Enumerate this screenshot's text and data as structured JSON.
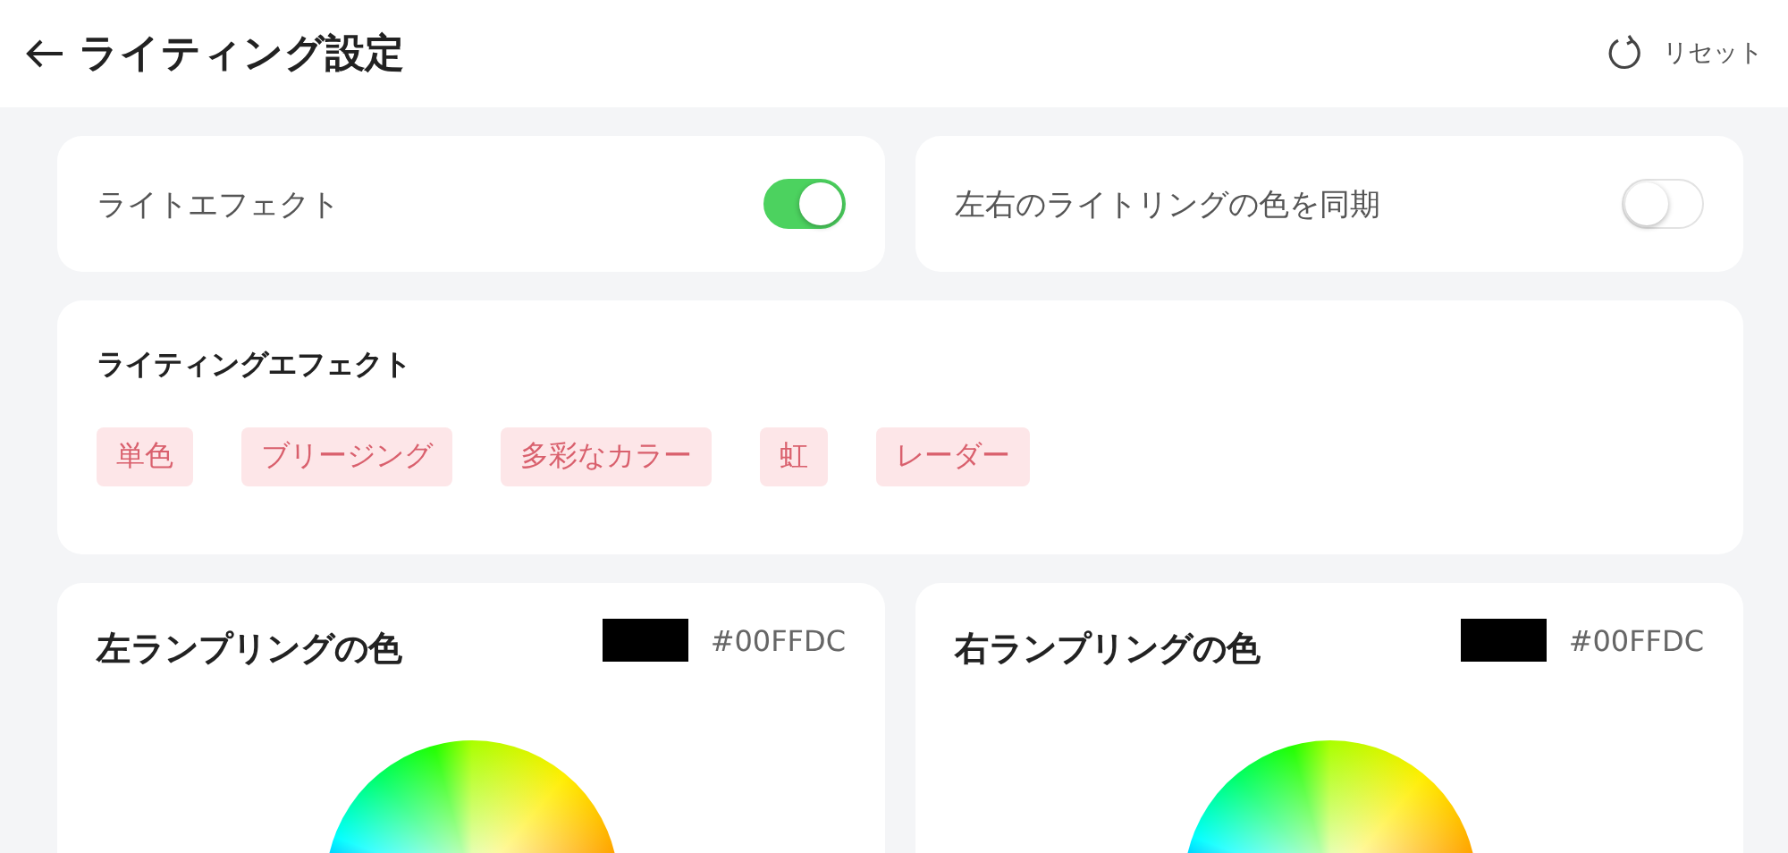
{
  "header": {
    "title": "ライティング設定",
    "reset_label": "リセット"
  },
  "toggles": [
    {
      "label": "ライトエフェクト",
      "on": true
    },
    {
      "label": "左右のライトリングの色を同期",
      "on": false
    }
  ],
  "effects": {
    "title": "ライティングエフェクト",
    "options": [
      {
        "label": "単色",
        "selected": false
      },
      {
        "label": "ブリージング",
        "selected": false
      },
      {
        "label": "多彩なカラー",
        "selected": false
      },
      {
        "label": "虹",
        "selected": false
      },
      {
        "label": "レーダー",
        "selected": false
      }
    ]
  },
  "rings": [
    {
      "title": "左ランプリングの色",
      "color": "#000000",
      "hex": "#00FFDC"
    },
    {
      "title": "右ランプリングの色",
      "color": "#000000",
      "hex": "#00FFDC"
    }
  ]
}
